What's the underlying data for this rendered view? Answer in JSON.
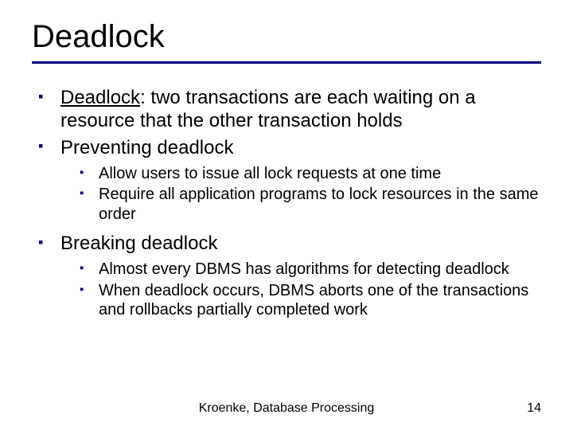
{
  "title": "Deadlock",
  "bullets": {
    "b1_term": "Deadlock",
    "b1_rest": ": two transactions are each waiting on a resource that the other transaction holds",
    "b2": "Preventing deadlock",
    "b2_sub": [
      "Allow users to issue all lock requests at one time",
      "Require all application programs to lock resources in the same order"
    ],
    "b3": "Breaking deadlock",
    "b3_sub": [
      "Almost every DBMS has algorithms for detecting deadlock",
      "When deadlock occurs, DBMS aborts one of the transactions and rollbacks partially completed work"
    ]
  },
  "footer": {
    "center": "Kroenke, Database Processing",
    "page": "14"
  }
}
